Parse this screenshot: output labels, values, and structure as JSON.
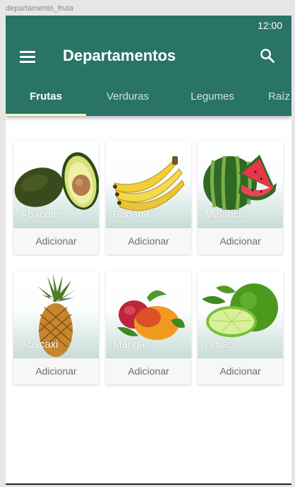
{
  "caption": "departamento_fruta",
  "status": {
    "time": "12:00"
  },
  "appbar": {
    "title": "Departamentos",
    "menu_icon": "menu-icon",
    "search_icon": "search-icon",
    "color": "#2a7467"
  },
  "tabs": [
    {
      "label": "Frutas",
      "active": true
    },
    {
      "label": "Verduras",
      "active": false
    },
    {
      "label": "Legumes",
      "active": false
    },
    {
      "label": "Raíz",
      "active": false
    }
  ],
  "products": [
    {
      "name": "Abacate",
      "action": "Adicionar",
      "icon": "avocado-image"
    },
    {
      "name": "Banana",
      "action": "Adicionar",
      "icon": "banana-image"
    },
    {
      "name": "Melância",
      "action": "Adicionar",
      "icon": "watermelon-image"
    },
    {
      "name": "Abacaxi",
      "action": "Adicionar",
      "icon": "pineapple-image"
    },
    {
      "name": "Manga",
      "action": "Adicionar",
      "icon": "mango-image"
    },
    {
      "name": "Limão",
      "action": "Adicionar",
      "icon": "lime-image"
    }
  ]
}
